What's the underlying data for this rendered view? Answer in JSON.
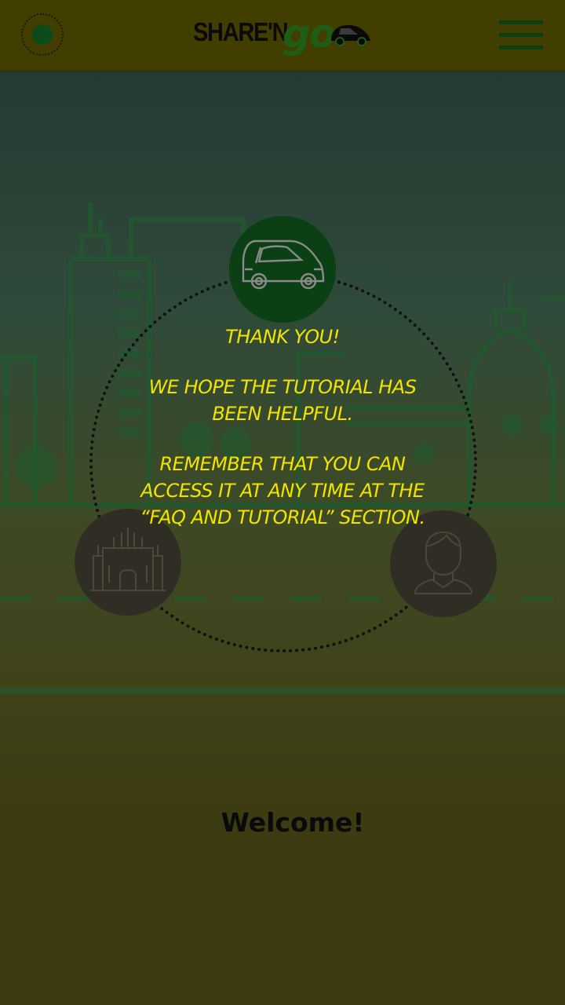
{
  "header": {
    "brand_prefix": "SHARE'N",
    "brand_suffix": "go",
    "status_icon": "status-dot-icon",
    "menu_icon": "hamburger-menu-icon"
  },
  "tutorial": {
    "icons": [
      "car-icon",
      "cathedral-icon",
      "user-icon"
    ],
    "line1": "THANK YOU!",
    "line2": "WE HOPE THE TUTORIAL HAS BEEN HELPFUL.",
    "line3": "REMEMBER THAT YOU CAN ACCESS IT AT ANY TIME AT THE “FAQ AND TUTORIAL” SECTION."
  },
  "main": {
    "welcome": "Welcome!"
  },
  "colors": {
    "overlay_bar": "#423e00",
    "accent_green": "#0b3f14",
    "text_yellow": "#f2e400"
  }
}
